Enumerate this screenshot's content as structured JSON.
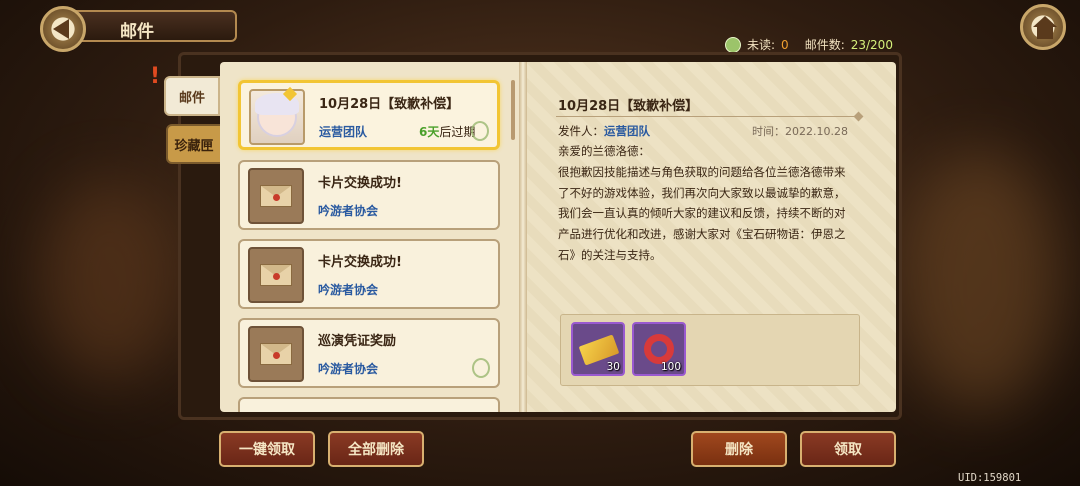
{
  "header": {
    "title": "邮件"
  },
  "stats": {
    "unread_label": "未读:",
    "unread_value": "0",
    "count_label": "邮件数:",
    "count_value": "23/200"
  },
  "tabs": [
    {
      "label": "邮件"
    },
    {
      "label": "珍藏匣"
    }
  ],
  "tab_alert": "!",
  "mails": [
    {
      "title": "10月28日【致歉补偿】",
      "sender": "运营团队",
      "expire_days": "6天",
      "expire_suffix": "后过期",
      "selected": true
    },
    {
      "title": "卡片交换成功!",
      "sender": "吟游者协会"
    },
    {
      "title": "卡片交换成功!",
      "sender": "吟游者协会"
    },
    {
      "title": "巡演凭证奖励",
      "sender": "吟游者协会"
    }
  ],
  "detail": {
    "title": "10月28日【致歉补偿】",
    "sender_label": "发件人：",
    "sender": "运营团队",
    "time": "时间：2022.10.28",
    "greeting": "亲爱的兰德洛德：",
    "body": "很抱歉因技能描述与角色获取的问题给各位兰德洛德带来了不好的游戏体验，我们再次向大家致以最诚挚的歉意，我们会一直认真的倾听大家的建议和反馈，持续不断的对产品进行优化和改进，感谢大家对《宝石研物语：伊恩之石》的关注与支持。",
    "attachments": [
      {
        "icon": "gold-ticket-icon",
        "qty": "30"
      },
      {
        "icon": "red-ring-icon",
        "qty": "100"
      }
    ]
  },
  "buttons": {
    "claim_all": "一键领取",
    "delete_all": "全部删除",
    "delete": "删除",
    "claim": "领取"
  },
  "uid": "UID:159801"
}
